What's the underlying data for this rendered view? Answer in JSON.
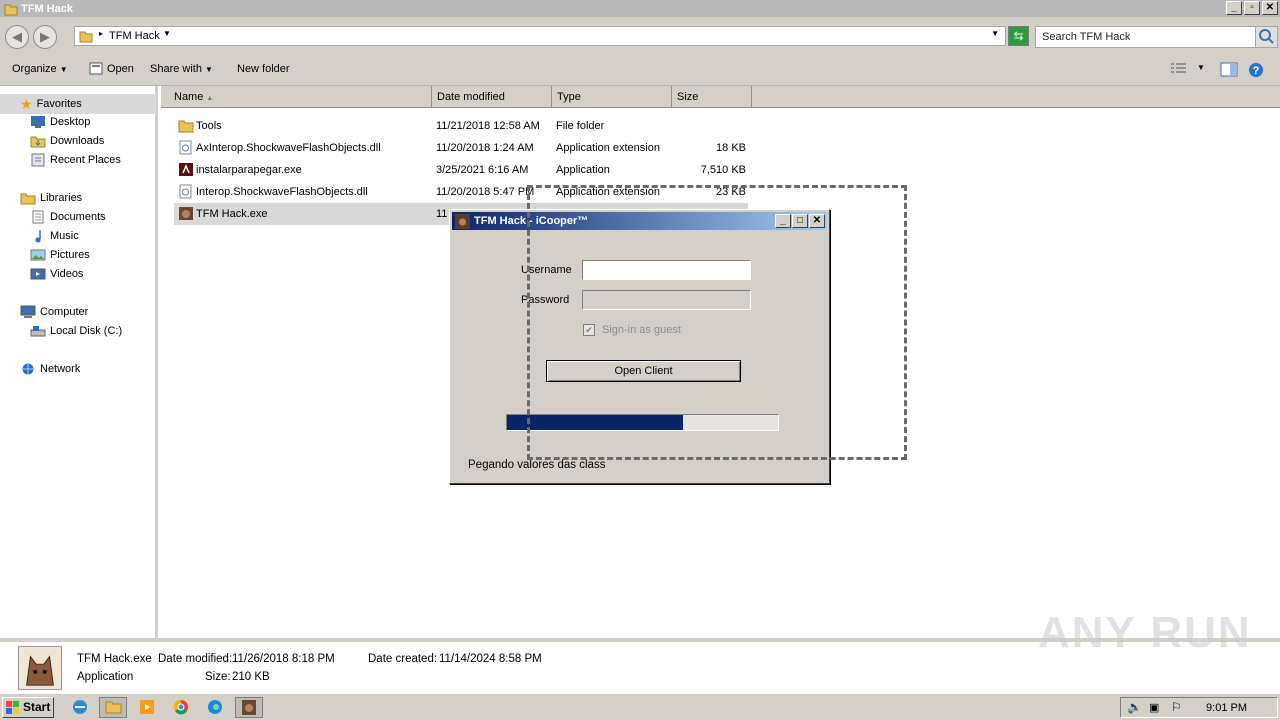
{
  "window": {
    "title": "TFM Hack"
  },
  "address": {
    "path": "TFM Hack",
    "search_placeholder": "Search TFM Hack"
  },
  "toolbar": {
    "organize": "Organize",
    "open": "Open",
    "share_with": "Share with",
    "new_folder": "New folder"
  },
  "sidebar": {
    "favorites": "Favorites",
    "favorites_items": [
      "Desktop",
      "Downloads",
      "Recent Places"
    ],
    "libraries": "Libraries",
    "libraries_items": [
      "Documents",
      "Music",
      "Pictures",
      "Videos"
    ],
    "computer": "Computer",
    "computer_items": [
      "Local Disk (C:)"
    ],
    "network": "Network"
  },
  "columns": {
    "name": "Name",
    "date": "Date modified",
    "type": "Type",
    "size": "Size"
  },
  "files": [
    {
      "name": "Tools",
      "date": "11/21/2018 12:58 AM",
      "type": "File folder",
      "size": ""
    },
    {
      "name": "AxInterop.ShockwaveFlashObjects.dll",
      "date": "11/20/2018 1:24 AM",
      "type": "Application extension",
      "size": "18 KB"
    },
    {
      "name": "instalarparapegar.exe",
      "date": "3/25/2021 6:16 AM",
      "type": "Application",
      "size": "7,510 KB"
    },
    {
      "name": "Interop.ShockwaveFlashObjects.dll",
      "date": "11/20/2018 5:47 PM",
      "type": "Application extension",
      "size": "23 KB"
    },
    {
      "name": "TFM Hack.exe",
      "date": "11",
      "type": "",
      "size": ""
    }
  ],
  "details": {
    "name": "TFM Hack.exe",
    "kind": "Application",
    "modified_label": "Date modified:",
    "modified": "11/26/2018 8:18 PM",
    "created_label": "Date created:",
    "created": "11/14/2024 8:58 PM",
    "size_label": "Size:",
    "size": "210 KB"
  },
  "dialog": {
    "title": "TFM Hack - iCooper™",
    "username_label": "Username",
    "password_label": "Password",
    "guest_label": "Sign-in as guest",
    "open_button": "Open Client",
    "progress": 0.65,
    "status": "Pegando valores das class"
  },
  "taskbar": {
    "start": "Start",
    "clock": "9:01 PM"
  },
  "watermark": "ANY RUN"
}
